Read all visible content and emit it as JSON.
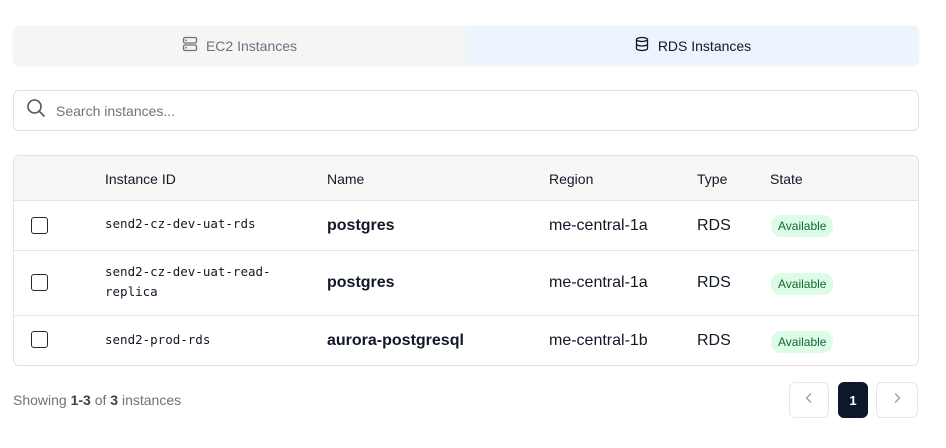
{
  "tabs": [
    {
      "label": "EC2 Instances",
      "icon": "server-icon",
      "active": false
    },
    {
      "label": "RDS Instances",
      "icon": "database-icon",
      "active": true
    }
  ],
  "search": {
    "placeholder": "Search instances...",
    "value": ""
  },
  "table": {
    "columns": [
      "Instance ID",
      "Name",
      "Region",
      "Type",
      "State"
    ],
    "rows": [
      {
        "id": "send2-cz-dev-uat-rds",
        "name": "postgres",
        "region": "me-central-1a",
        "type": "RDS",
        "state": "Available"
      },
      {
        "id": "send2-cz-dev-uat-read-replica",
        "id_line1": "send2-cz-dev-uat-read-",
        "id_line2": "replica",
        "name": "postgres",
        "region": "me-central-1a",
        "type": "RDS",
        "state": "Available"
      },
      {
        "id": "send2-prod-rds",
        "name": "aurora-postgresql",
        "region": "me-central-1b",
        "type": "RDS",
        "state": "Available"
      }
    ]
  },
  "footer": {
    "prefix": "Showing",
    "range": "1-3",
    "of": "of",
    "total": "3",
    "suffix": "instances"
  },
  "pagination": {
    "current_page": "1"
  },
  "colors": {
    "active_tab_bg": "#eef4fd",
    "badge_bg": "#dcfce7",
    "badge_text": "#166534",
    "page_active_bg": "#0f172a"
  }
}
